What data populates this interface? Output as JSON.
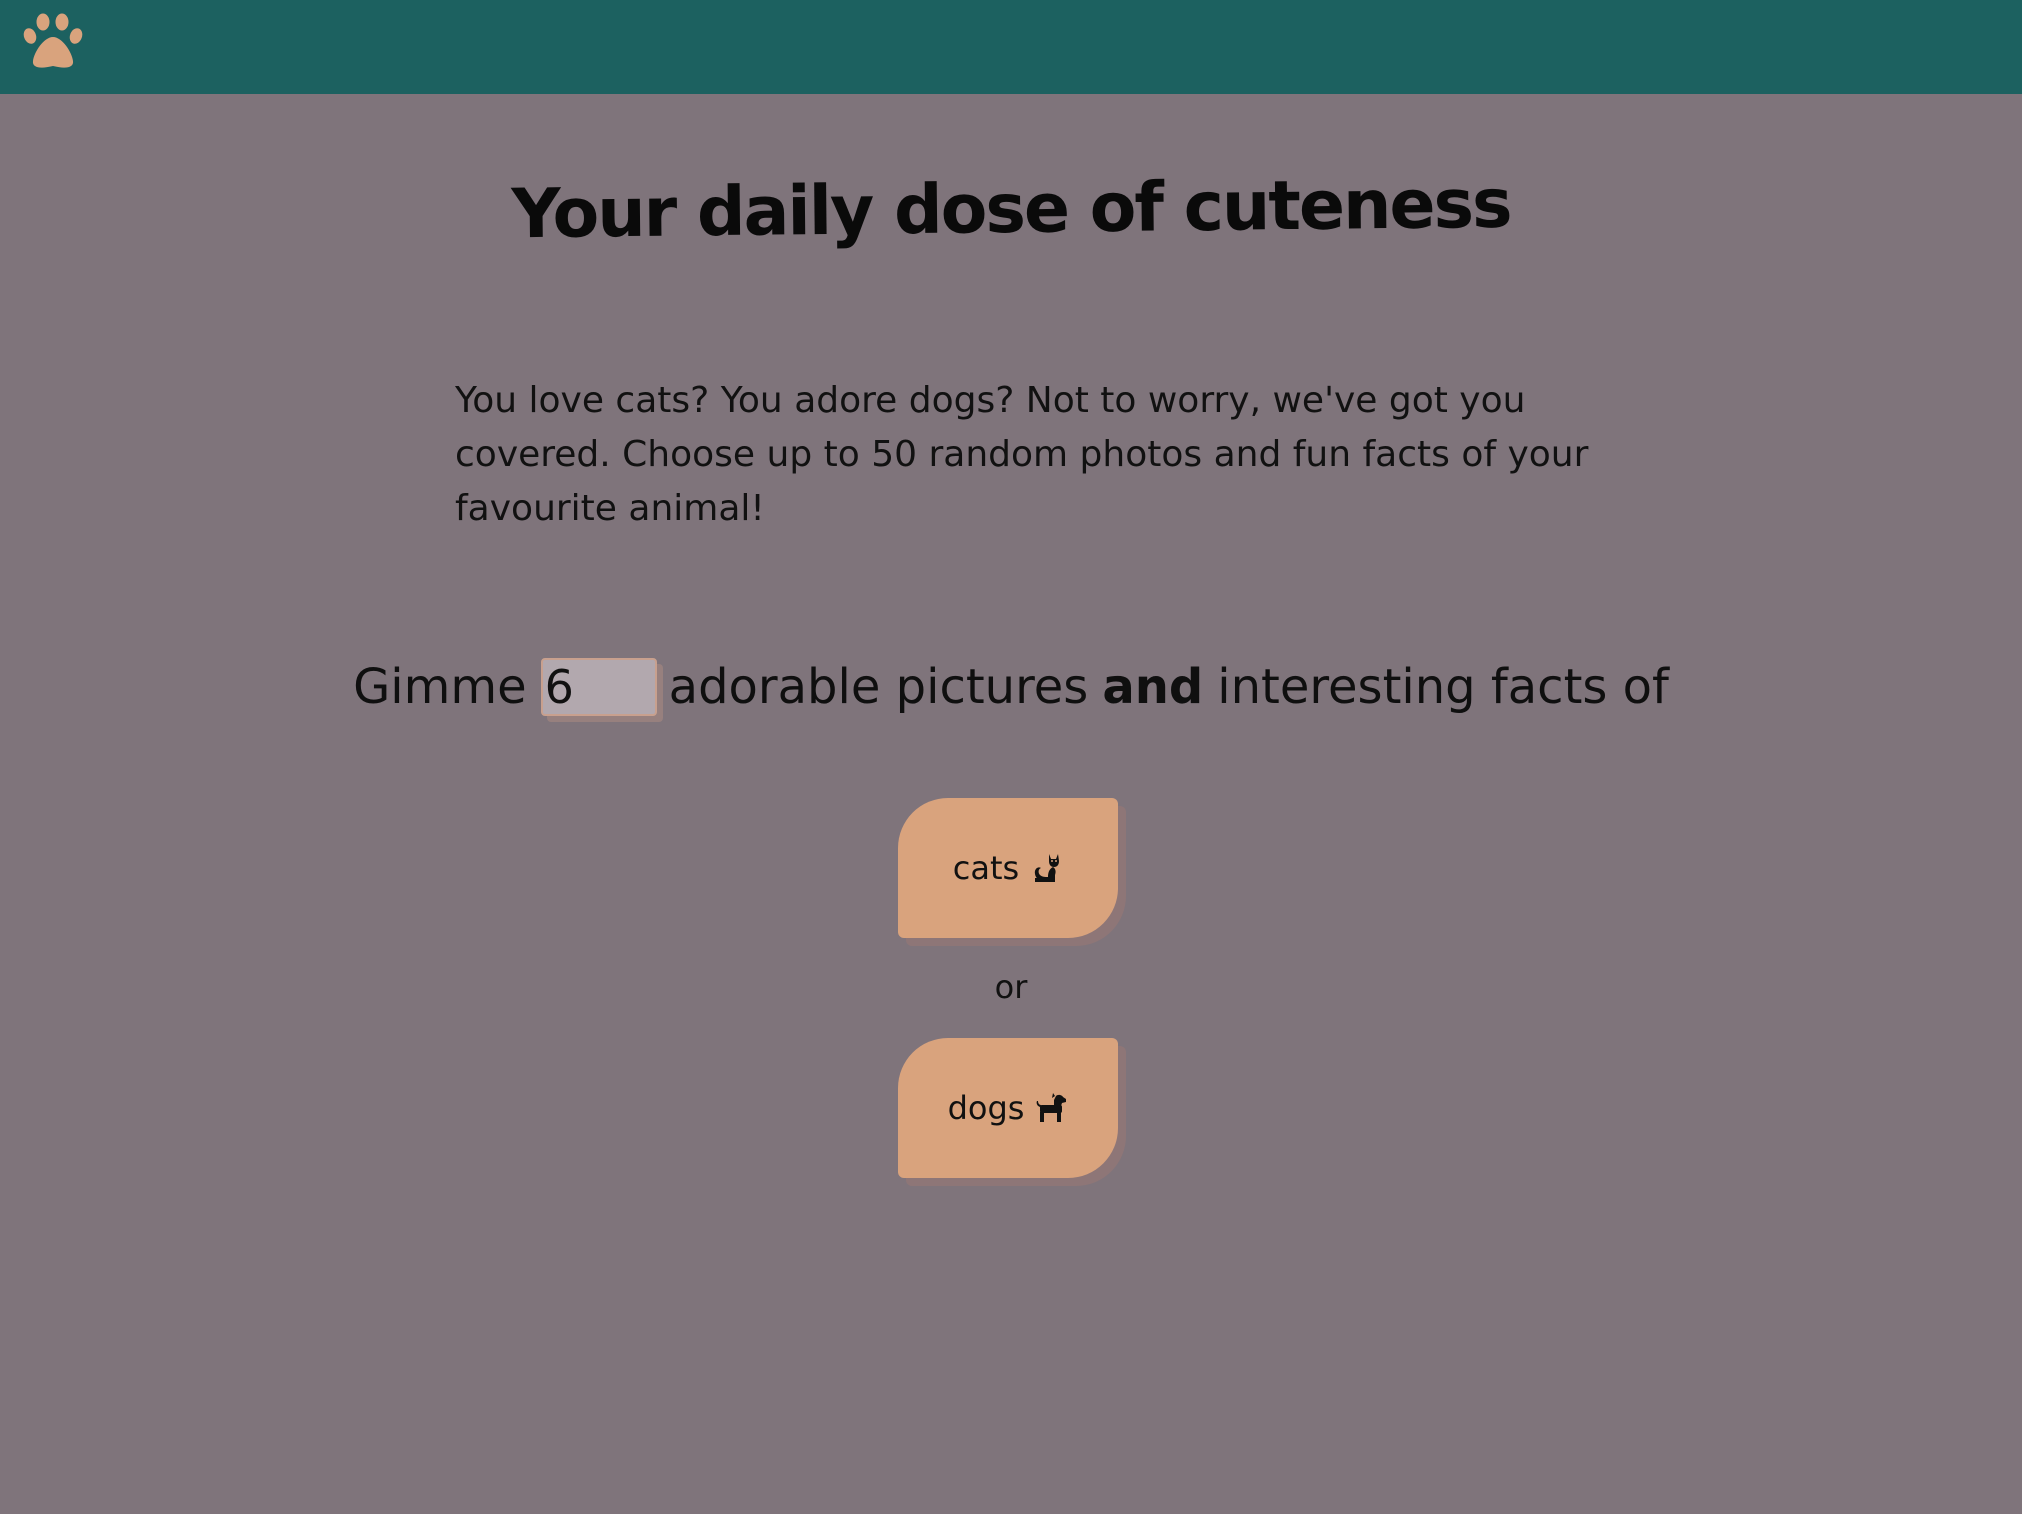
{
  "header": {
    "logo_icon": "paw-icon",
    "logo_color": "#d9a37d",
    "background": "#1c6160"
  },
  "page": {
    "title": "Your daily dose of cuteness",
    "intro": "You love cats? You adore dogs? Not to worry, we've got you covered. Choose up to 50 random photos and fun facts of your favourite animal!",
    "background": "#7f747b"
  },
  "form": {
    "prefix": "Gimme",
    "count_value": "6",
    "middle": "adorable pictures",
    "emphasis": "and",
    "suffix": "interesting facts of",
    "or_text": "or",
    "cats_label": "cats",
    "cats_icon": "cat-icon",
    "dogs_label": "dogs",
    "dogs_icon": "dog-icon",
    "button_color": "#d9a37d"
  }
}
